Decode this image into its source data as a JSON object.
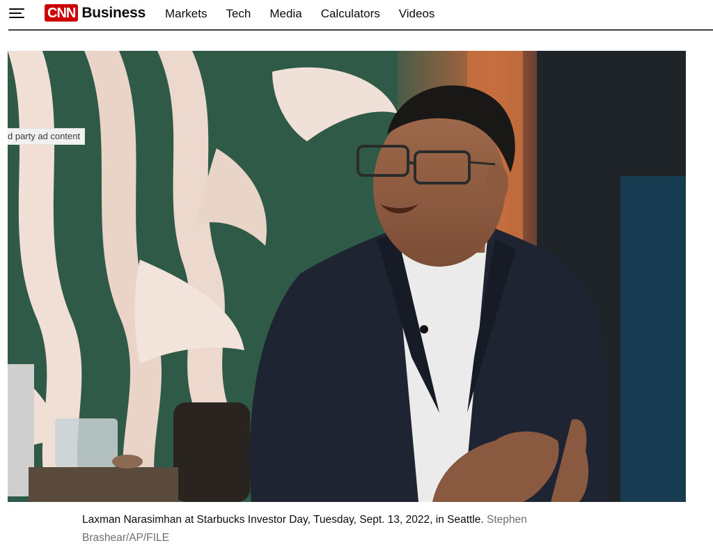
{
  "header": {
    "logo": {
      "brand": "CNN",
      "section": "Business"
    },
    "nav": [
      "Markets",
      "Tech",
      "Media",
      "Calculators",
      "Videos"
    ]
  },
  "ad_label": "d party ad content",
  "photo": {
    "description_icon": "photo-of-man-in-suit",
    "caption": "Laxman Narasimhan at Starbucks Investor Day, Tuesday, Sept. 13, 2022, in Seattle.",
    "credit": "Stephen Brashear/AP/FILE"
  },
  "colors": {
    "brand_red": "#cc0000",
    "text": "#0c0c0c",
    "credit_gray": "#6e6e6e"
  }
}
